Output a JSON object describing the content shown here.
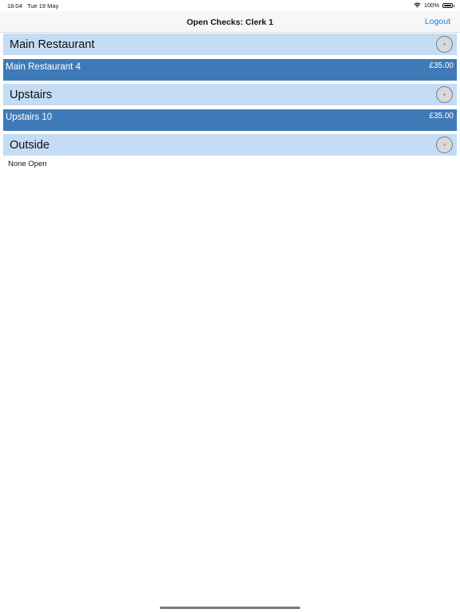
{
  "status_bar": {
    "time": "18:04",
    "date": "Tue 19 May",
    "battery": "100%"
  },
  "nav": {
    "title": "Open Checks: Clerk 1",
    "logout_label": "Logout"
  },
  "sections": [
    {
      "title": "Main Restaurant",
      "checks": [
        {
          "name": "Main Restaurant 4",
          "amount": "£35.00"
        }
      ]
    },
    {
      "title": "Upstairs",
      "checks": [
        {
          "name": "Upstairs 10",
          "amount": "£35.00"
        }
      ]
    },
    {
      "title": "Outside",
      "checks": [],
      "empty_text": "None Open"
    }
  ],
  "colors": {
    "section_header": "#c5dcf5",
    "check_row": "#3f7ab8",
    "link": "#1a7fe0"
  }
}
